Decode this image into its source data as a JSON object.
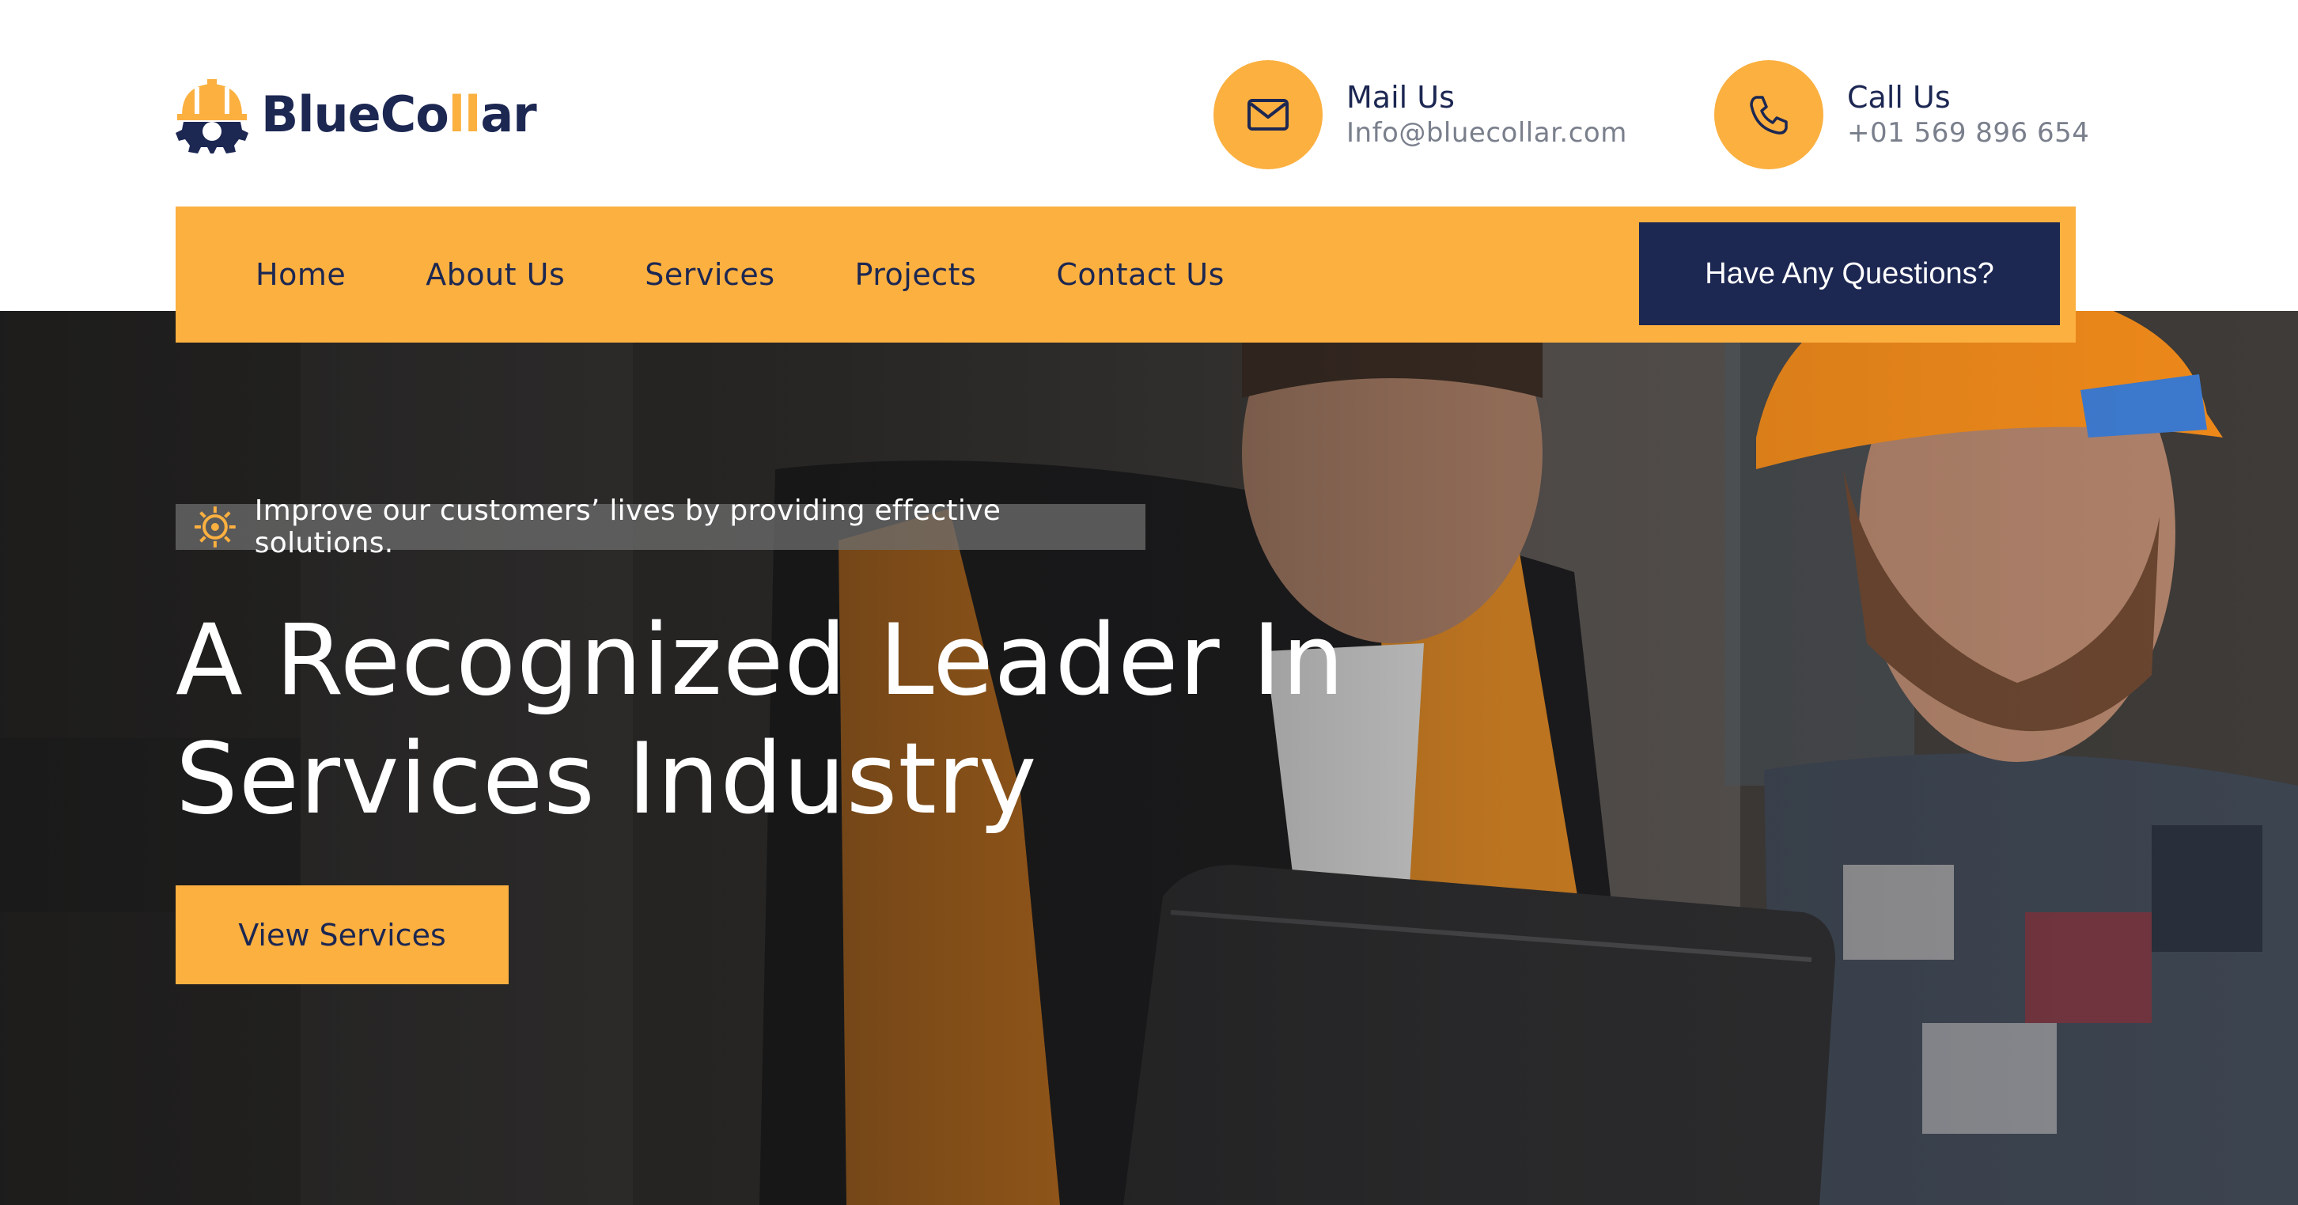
{
  "brand": {
    "name_part1": "BlueCo",
    "name_accent": "ll",
    "name_part2": "ar"
  },
  "contacts": {
    "mail": {
      "title": "Mail Us",
      "value": "Info@bluecollar.com",
      "icon": "envelope-icon"
    },
    "call": {
      "title": "Call Us",
      "value": "+01 569 896 654",
      "icon": "phone-icon"
    }
  },
  "nav": {
    "items": [
      "Home",
      "About Us",
      "Services",
      "Projects",
      "Contact Us"
    ],
    "cta": "Have Any Questions?"
  },
  "hero": {
    "tagline": "Improve our customers’ lives by providing effective solutions.",
    "tagline_icon": "gear-icon",
    "headline_line1": "A Recognized Leader In",
    "headline_line2": "Services Industry",
    "button": "View Services"
  },
  "colors": {
    "primary": "#1c2752",
    "accent": "#fbb040",
    "white": "#ffffff",
    "muted": "#7a7f8c"
  }
}
